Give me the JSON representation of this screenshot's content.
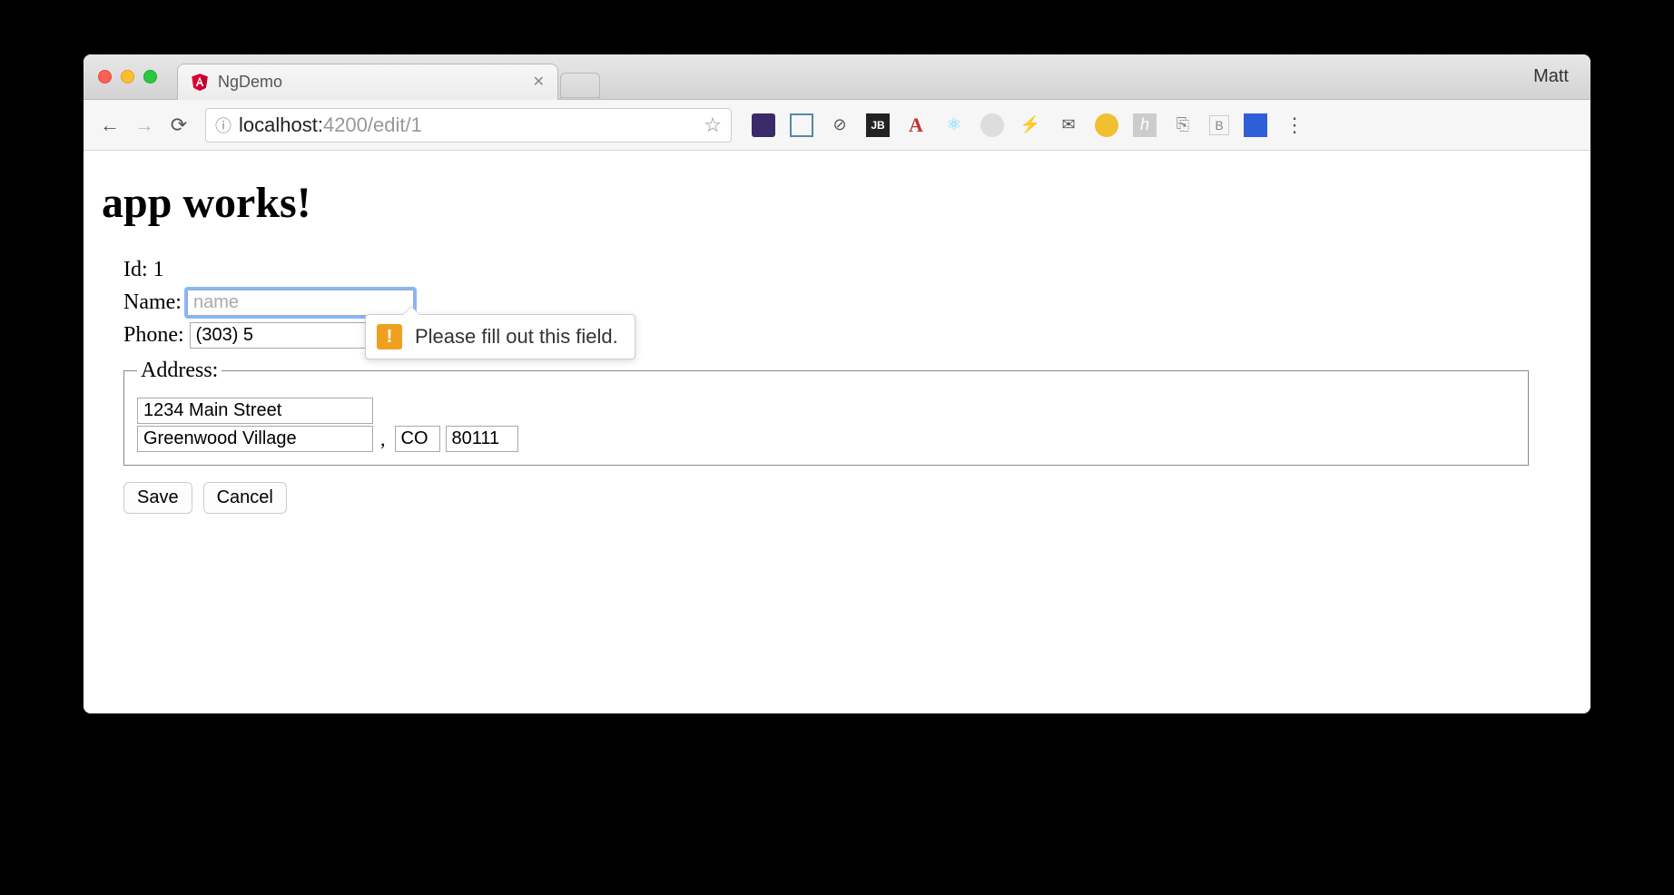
{
  "browser": {
    "profile_name": "Matt",
    "tab_title": "NgDemo",
    "url_host": "localhost:",
    "url_path": "4200/edit/1"
  },
  "page": {
    "heading": "app works!",
    "id_label": "Id:",
    "id_value": "1",
    "name_label": "Name:",
    "name_placeholder": "name",
    "name_value": "",
    "phone_label": "Phone:",
    "phone_value": "(303) 5",
    "address_legend": "Address:",
    "street_value": "1234 Main Street",
    "city_value": "Greenwood Village",
    "state_value": "CO",
    "zip_value": "80111",
    "save_label": "Save",
    "cancel_label": "Cancel"
  },
  "validation": {
    "message": "Please fill out this field."
  }
}
